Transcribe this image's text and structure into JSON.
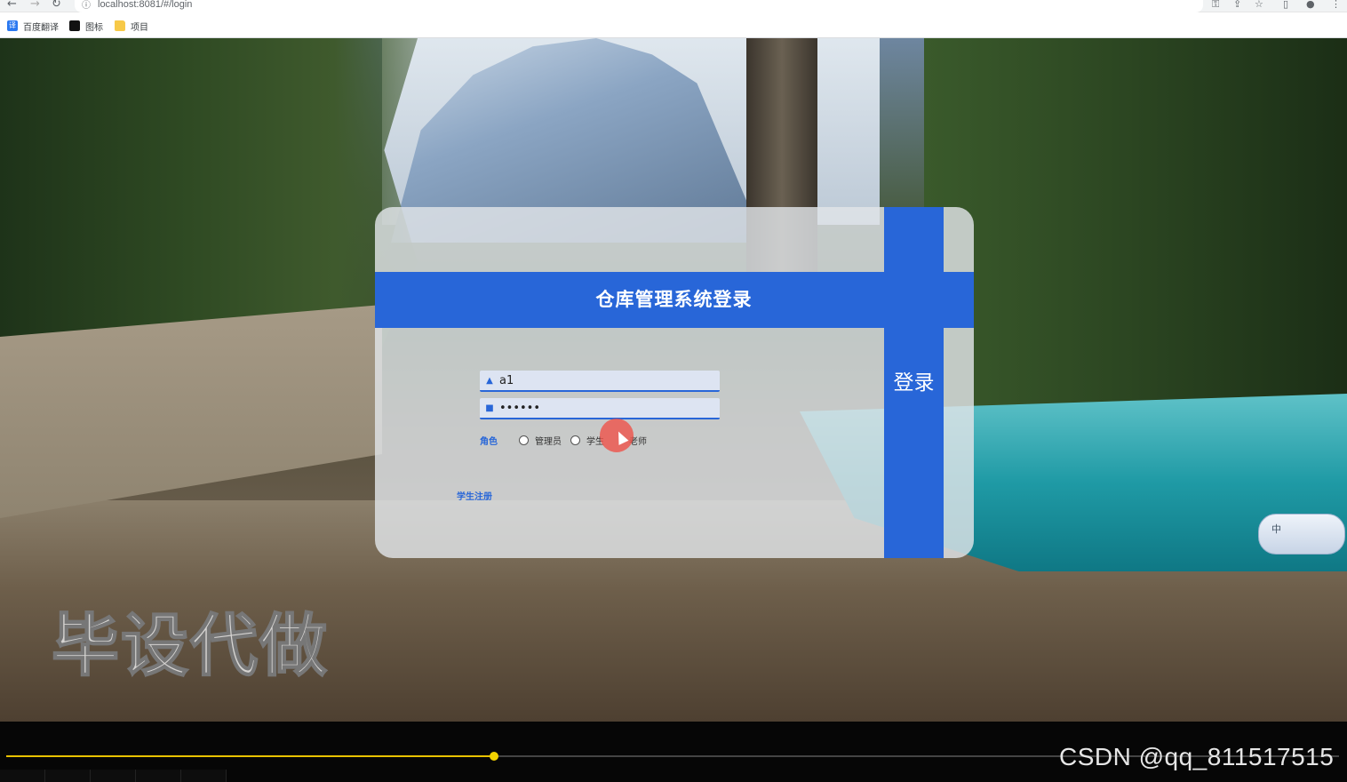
{
  "browser": {
    "url": "localhost:8081/#/login",
    "bookmarks": [
      {
        "label": "百度翻译",
        "icon": "translate-icon"
      },
      {
        "label": "图标",
        "icon": "image-icon"
      },
      {
        "label": "项目",
        "icon": "folder-icon"
      }
    ]
  },
  "login": {
    "title": "仓库管理系统登录",
    "submit_label": "登录",
    "username_value": "a1",
    "password_value": "••••••",
    "role_label": "角色",
    "roles": [
      "管理员",
      "学生",
      "老师"
    ],
    "register_link": "学生注册"
  },
  "ime": {
    "mode": "中"
  },
  "watermark": "毕设代做",
  "player": {
    "progress_fraction": 0.366,
    "credit": "CSDN @qq_811517515"
  },
  "colors": {
    "primary": "#2866d8",
    "progress": "#e8c100"
  }
}
